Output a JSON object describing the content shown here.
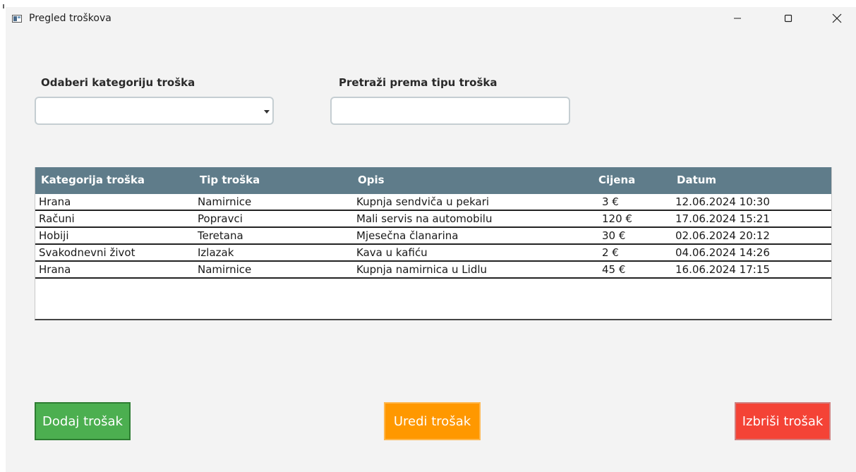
{
  "window": {
    "title": "Pregled troškova"
  },
  "filters": {
    "category_label": "Odaberi kategoriju troška",
    "category_value": "",
    "search_label": "Pretraži prema tipu troška",
    "search_value": ""
  },
  "table": {
    "columns": [
      "Kategorija troška",
      "Tip troška",
      "Opis",
      "Cijena",
      "Datum"
    ],
    "rows": [
      [
        "Hrana",
        "Namirnice",
        "Kupnja sendviča u pekari",
        "3 €",
        "12.06.2024 10:30"
      ],
      [
        "Računi",
        "Popravci",
        "Mali servis na automobilu",
        "120 €",
        "17.06.2024 15:21"
      ],
      [
        "Hobiji",
        "Teretana",
        "Mjesečna članarina",
        "30 €",
        "02.06.2024 20:12"
      ],
      [
        "Svakodnevni život",
        "Izlazak",
        "Kava u kafiću",
        "2 €",
        "04.06.2024 14:26"
      ],
      [
        "Hrana",
        "Namirnice",
        "Kupnja namirnica u Lidlu",
        "45 €",
        "16.06.2024 17:15"
      ]
    ]
  },
  "actions": {
    "add_label": "Dodaj trošak",
    "edit_label": "Uredi trošak",
    "delete_label": "Izbriši trošak"
  },
  "colors": {
    "header_bg": "#5f7c8a",
    "add": "#4caf50",
    "edit": "#ff9800",
    "delete": "#f44336"
  },
  "icons": [
    "app-icon",
    "minimize-icon",
    "maximize-icon",
    "close-icon",
    "dropdown-arrow-icon"
  ]
}
